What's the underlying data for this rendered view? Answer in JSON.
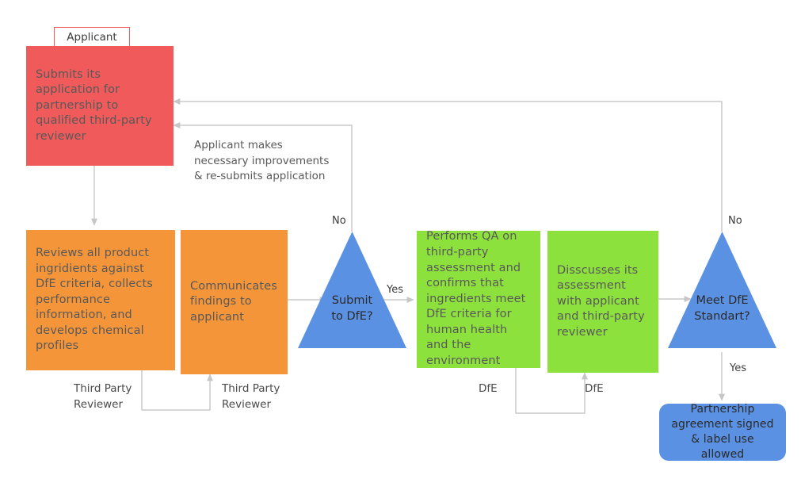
{
  "diagram": {
    "title": "Design for the Environment (DfE) Partnership Process Flowchart",
    "background": "#FFFFFF",
    "colors": {
      "applicant": "#F05A5A",
      "third_party_reviewer": "#F59539",
      "dfe": "#8DE13D",
      "decision": "#5A91E3",
      "terminator": "#5A91E3",
      "connector": "#BFBFBF",
      "text": "#595959"
    }
  },
  "lane_tabs": [
    {
      "id": "applicant-tab",
      "label": "Applicant"
    }
  ],
  "nodes": [
    {
      "id": "submits-application",
      "shape": "process",
      "lane": "Applicant",
      "color": "#F05A5A",
      "text": "Submits its application for partnership to qualified third-party reviewer"
    },
    {
      "id": "reviews-ingredients",
      "shape": "process",
      "lane": "Third Party Reviewer",
      "color": "#F59539",
      "text": "Reviews all product ingridients against DfE criteria, collects performance information, and develops chemical profiles"
    },
    {
      "id": "communicates-findings",
      "shape": "process",
      "lane": "Third Party Reviewer",
      "color": "#F59539",
      "text": "Communicates findings to applicant"
    },
    {
      "id": "submit-to-dfe",
      "shape": "decision-triangle",
      "color": "#5A91E3",
      "text": "Submit\nto DfE?"
    },
    {
      "id": "performs-qa",
      "shape": "process",
      "lane": "DfE",
      "color": "#8DE13D",
      "text": "Performs QA on third-party assessment and confirms that ingredients meet DfE criteria for human health and the environment"
    },
    {
      "id": "discusses-assessment",
      "shape": "process",
      "lane": "DfE",
      "color": "#8DE13D",
      "text": "Disscusses its assessment with applicant and third-party reviewer"
    },
    {
      "id": "meet-dfe-standard",
      "shape": "decision-triangle",
      "color": "#5A91E3",
      "text": "Meet DfE\nStandart?"
    },
    {
      "id": "partnership-signed",
      "shape": "terminator",
      "color": "#5A91E3",
      "text": "Partnership agreement signed & label use allowed"
    }
  ],
  "annotations": [
    {
      "id": "resubmit-note",
      "text": "Applicant makes necessary improvements & re-submits application"
    }
  ],
  "edge_labels": [
    {
      "id": "submit-no",
      "text": "No"
    },
    {
      "id": "submit-yes",
      "text": "Yes"
    },
    {
      "id": "meet-no",
      "text": "No"
    },
    {
      "id": "meet-yes",
      "text": "Yes"
    }
  ],
  "lane_labels": [
    {
      "id": "lane-tpr-1",
      "text": "Third Party\nReviewer"
    },
    {
      "id": "lane-tpr-2",
      "text": "Third Party\nReviewer"
    },
    {
      "id": "lane-dfe-1",
      "text": "DfE"
    },
    {
      "id": "lane-dfe-2",
      "text": "DfE"
    }
  ]
}
